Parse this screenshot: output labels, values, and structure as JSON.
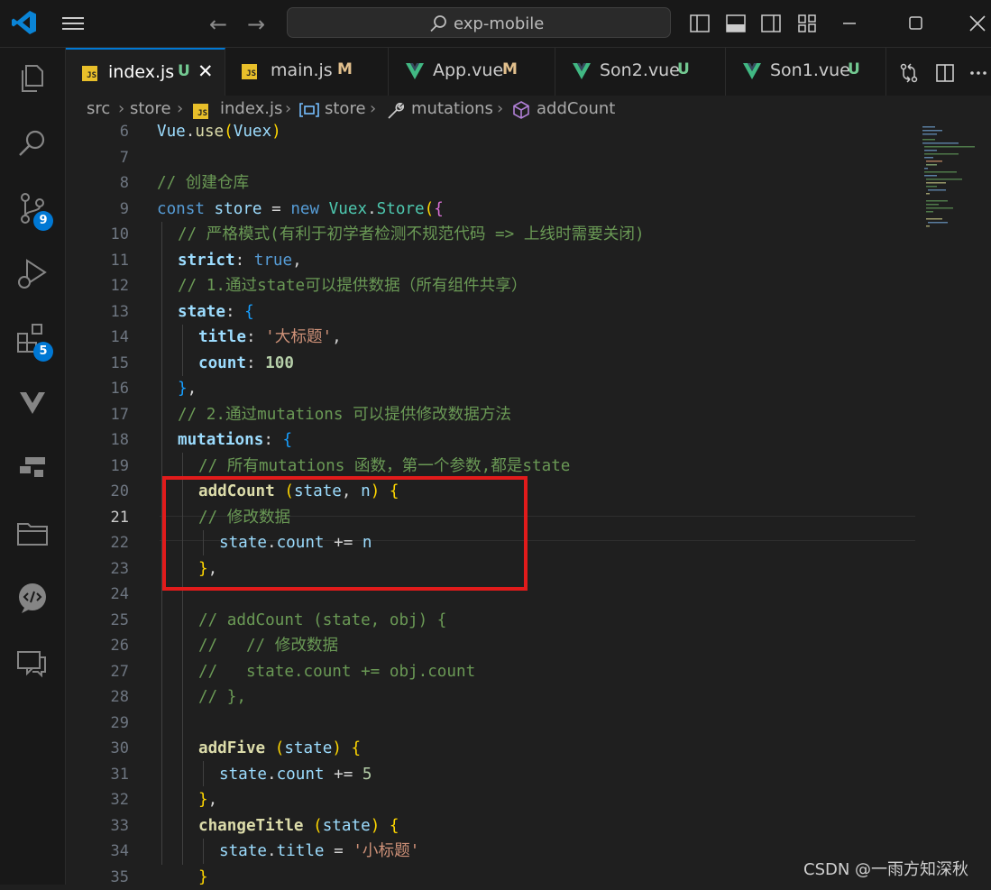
{
  "titlebar": {
    "search_text": "exp-mobile"
  },
  "activity": {
    "source_control_badge": "9",
    "extensions_badge": "5"
  },
  "tabs": [
    {
      "name": "index.js",
      "status": "U",
      "type": "js",
      "active": true
    },
    {
      "name": "main.js",
      "status": "M",
      "type": "js"
    },
    {
      "name": "App.vue",
      "status": "M",
      "type": "vue"
    },
    {
      "name": "Son2.vue",
      "status": "U",
      "type": "vue"
    },
    {
      "name": "Son1.vue",
      "status": "U",
      "type": "vue"
    }
  ],
  "breadcrumb": [
    "src",
    "store",
    "index.js",
    "store",
    "mutations",
    "addCount"
  ],
  "line_numbers": [
    "6",
    "7",
    "8",
    "9",
    "10",
    "11",
    "12",
    "13",
    "14",
    "15",
    "16",
    "17",
    "18",
    "19",
    "20",
    "21",
    "22",
    "23",
    "24",
    "25",
    "26",
    "27",
    "28",
    "29",
    "30",
    "31",
    "32",
    "33",
    "34",
    "35"
  ],
  "code": {
    "l6": {
      "a": "Vue",
      "b": ".",
      "c": "use",
      "d": "(",
      "e": "Vuex",
      "f": ")"
    },
    "l8": "// 创建仓库",
    "l9": {
      "kw": "const",
      "var": " store ",
      "op": "= ",
      "new": "new",
      "cls1": " Vuex",
      "dot": ".",
      "cls2": "Store",
      "p": "(",
      "b": "{"
    },
    "l10": "// 严格模式(有利于初学者检测不规范代码 => 上线时需要关闭)",
    "l11": {
      "prop": "strict",
      "colon": ": ",
      "val": "true",
      "comma": ","
    },
    "l12": "// 1.通过state可以提供数据（所有组件共享）",
    "l13": {
      "prop": "state",
      "colon": ": ",
      "b": "{"
    },
    "l14": {
      "prop": "title",
      "colon": ": ",
      "str": "'大标题'",
      "comma": ","
    },
    "l15": {
      "prop": "count",
      "colon": ": ",
      "num": "100"
    },
    "l16": {
      "b": "}",
      "comma": ","
    },
    "l17": "// 2.通过mutations 可以提供修改数据方法",
    "l18": {
      "prop": "mutations",
      "colon": ": ",
      "b": "{"
    },
    "l19": "// 所有mutations 函数，第一个参数,都是state",
    "l20": {
      "fn": "addCount",
      "sp": " ",
      "p1": "(",
      "a1": "state",
      "c": ", ",
      "a2": "n",
      "p2": ")",
      "sp2": " ",
      "b": "{"
    },
    "l21": "// 修改数据",
    "l22": {
      "v": "state",
      "d": ".",
      "p": "count",
      "op": " += ",
      "n": "n"
    },
    "l23": {
      "b": "}",
      "comma": ","
    },
    "l25": "// addCount (state, obj) {",
    "l26": "//   // 修改数据",
    "l27": "//   state.count += obj.count",
    "l28": "// },",
    "l30": {
      "fn": "addFive",
      "sp": " ",
      "p1": "(",
      "a1": "state",
      "p2": ")",
      "sp2": " ",
      "b": "{"
    },
    "l31": {
      "v": "state",
      "d": ".",
      "p": "count",
      "op": " += ",
      "num": "5"
    },
    "l32": {
      "b": "}",
      "comma": ","
    },
    "l33": {
      "fn": "changeTitle",
      "sp": " ",
      "p1": "(",
      "a1": "state",
      "p2": ")",
      "sp2": " ",
      "b": "{"
    },
    "l34": {
      "v": "state",
      "d": ".",
      "p": "title",
      "op": " = ",
      "str": "'小标题'"
    },
    "l35": {
      "b": "}"
    }
  },
  "watermark": "CSDN @一雨方知深秋",
  "colors": {
    "accent": "#0078d4",
    "highlight_box": "#e11b1b",
    "editor_bg": "#1f1f1f"
  }
}
